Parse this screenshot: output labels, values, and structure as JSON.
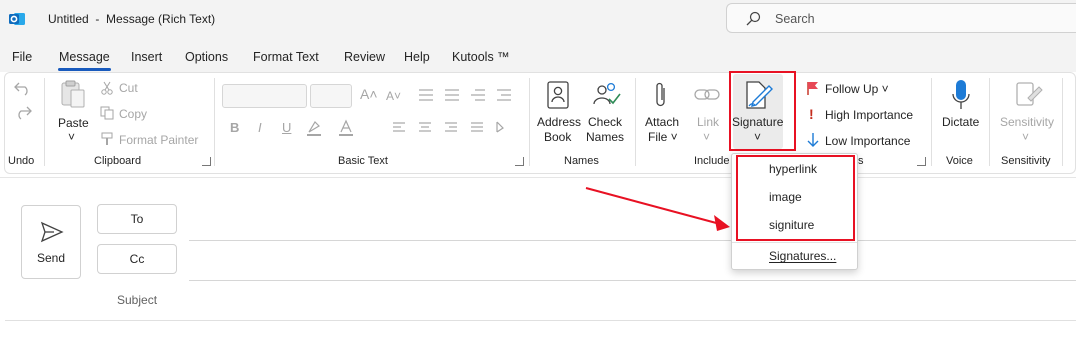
{
  "window": {
    "title": "Untitled  -  Message (Rich Text)",
    "search_placeholder": "Search"
  },
  "tabs": [
    "File",
    "Message",
    "Insert",
    "Options",
    "Format Text",
    "Review",
    "Help",
    "Kutools ™"
  ],
  "active_tab": "Message",
  "ribbon": {
    "undo": {
      "group": "Undo"
    },
    "clipboard": {
      "group": "Clipboard",
      "paste": "Paste",
      "cut": "Cut",
      "copy": "Copy",
      "format_painter": "Format Painter"
    },
    "basic_text": {
      "group": "Basic Text",
      "bold": "B",
      "italic": "I",
      "underline": "U"
    },
    "names": {
      "group": "Names",
      "address_book_1": "Address",
      "address_book_2": "Book",
      "check_names_1": "Check",
      "check_names_2": "Names"
    },
    "include": {
      "group": "Include",
      "attach_1": "Attach",
      "attach_2": "File ˅",
      "link_1": "Link",
      "link_2": "˅",
      "signature": "Signature",
      "signature_caret": "˅"
    },
    "tags": {
      "group_tail": "s",
      "follow_up": "Follow Up ˅",
      "high": "High Importance",
      "low": "Low Importance"
    },
    "voice": {
      "group": "Voice",
      "dictate": "Dictate"
    },
    "sensitivity": {
      "group": "Sensitivity",
      "label": "Sensitivity",
      "caret": "˅"
    }
  },
  "signature_menu": {
    "items": [
      "hyperlink",
      "image",
      "signiture"
    ],
    "footer": "Signatures..."
  },
  "compose": {
    "send": "Send",
    "to": "To",
    "cc": "Cc",
    "subject": "Subject"
  },
  "colors": {
    "accent": "#185abd",
    "highlight": "#e81123",
    "arrow": "#e81123"
  }
}
